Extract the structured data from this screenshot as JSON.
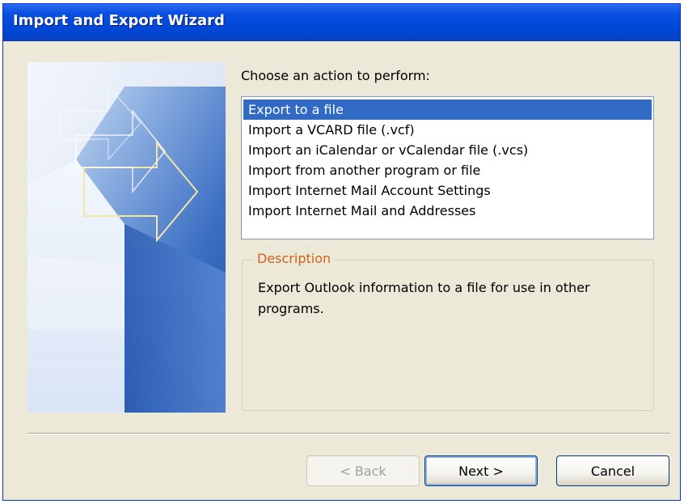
{
  "window": {
    "title": "Import and Export Wizard"
  },
  "wizard": {
    "prompt": "Choose an action to perform:",
    "actions": [
      {
        "label": "Export to a file",
        "selected": true
      },
      {
        "label": "Import a VCARD file (.vcf)",
        "selected": false
      },
      {
        "label": "Import an iCalendar or vCalendar file (.vcs)",
        "selected": false
      },
      {
        "label": "Import from another program or file",
        "selected": false
      },
      {
        "label": "Import Internet Mail Account Settings",
        "selected": false
      },
      {
        "label": "Import Internet Mail and Addresses",
        "selected": false
      }
    ],
    "description": {
      "label": "Description",
      "text": "Export Outlook information to a file for use in other programs."
    }
  },
  "buttons": {
    "back": "< Back",
    "next": "Next >",
    "cancel": "Cancel"
  },
  "colors": {
    "titlebar": "#0047d6",
    "selection": "#316ac5",
    "group_label": "#d2601a",
    "dialog_bg": "#ece9d8"
  },
  "icons": {
    "banner": "wizard-arrows-banner-graphic"
  }
}
